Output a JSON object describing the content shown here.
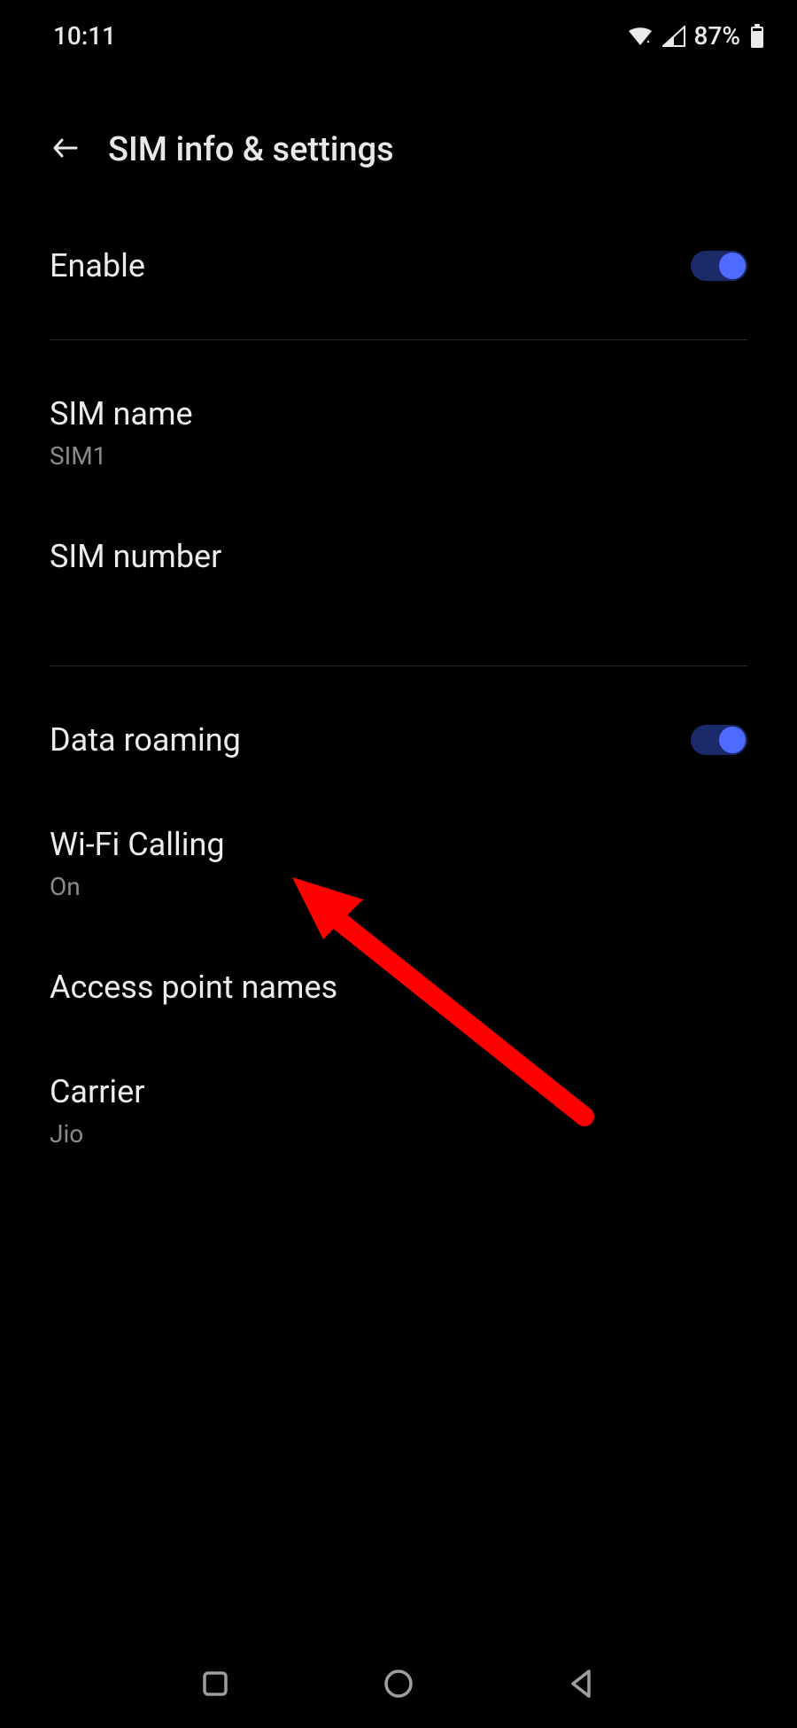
{
  "status": {
    "time": "10:11",
    "battery_pct": "87%"
  },
  "header": {
    "title": "SIM info & settings"
  },
  "rows": {
    "enable": {
      "title": "Enable"
    },
    "sim_name": {
      "title": "SIM name",
      "value": "SIM1"
    },
    "sim_number": {
      "title": "SIM number",
      "value": ""
    },
    "data_roaming": {
      "title": "Data roaming"
    },
    "wifi_calling": {
      "title": "Wi-Fi Calling",
      "value": "On"
    },
    "apn": {
      "title": "Access point names"
    },
    "carrier": {
      "title": "Carrier",
      "value": "Jio"
    }
  }
}
